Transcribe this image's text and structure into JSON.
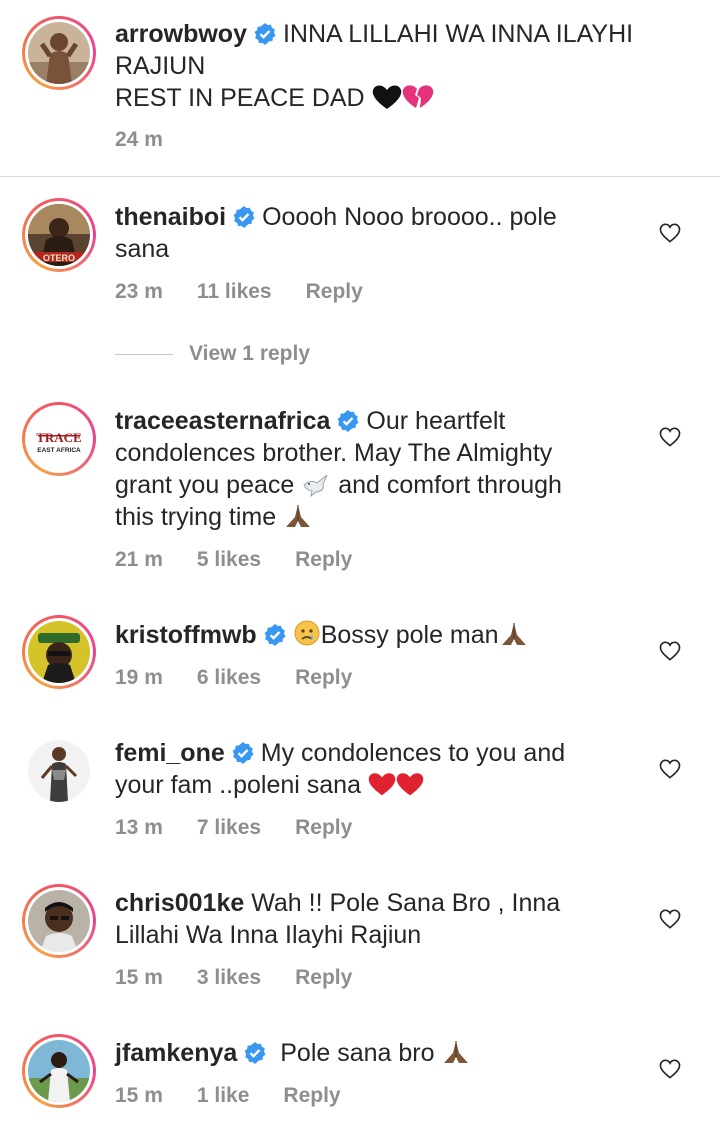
{
  "caption": {
    "username": "arrowbwoy",
    "text_line1": "INNA LILLAHI WA INNA ILAYHI",
    "text_line2": "RAJIUN",
    "text_line3": "REST IN PEACE DAD",
    "time": "24 m"
  },
  "comments": [
    {
      "username": "thenaiboi",
      "verified": true,
      "text1": "Ooooh Nooo broooo.. pole",
      "text2": "sana",
      "time": "23 m",
      "likes": "11 likes",
      "reply": "Reply"
    },
    {
      "username": "traceeasternafrica",
      "verified": true,
      "text1": "Our heartfelt",
      "text2": "condolences brother. May The Almighty",
      "text3a": "grant you peace",
      "text3b": "and comfort through",
      "text4": "this trying time",
      "time": "21 m",
      "likes": "5 likes",
      "reply": "Reply",
      "avatar_text1": "TRACE",
      "avatar_text2": "EAST AFRICA"
    },
    {
      "username": "kristoffmwb",
      "verified": true,
      "text1": "Bossy pole man",
      "time": "19 m",
      "likes": "6 likes",
      "reply": "Reply"
    },
    {
      "username": "femi_one",
      "verified": true,
      "text1": "My condolences to you and",
      "text2": "your fam ..poleni sana",
      "time": "13 m",
      "likes": "7 likes",
      "reply": "Reply"
    },
    {
      "username": "chris001ke",
      "verified": false,
      "text1": "Wah !! Pole Sana Bro , Inna",
      "text2": "Lillahi Wa Inna Ilayhi Rajiun",
      "time": "15 m",
      "likes": "3 likes",
      "reply": "Reply"
    },
    {
      "username": "jfamkenya",
      "verified": true,
      "text1": "Pole sana bro",
      "time": "15 m",
      "likes": "1 like",
      "reply": "Reply"
    }
  ],
  "view_replies": "View 1 reply",
  "colors": {
    "verified": "#3897f0",
    "meta": "#8e8e8e",
    "text": "#262626"
  }
}
